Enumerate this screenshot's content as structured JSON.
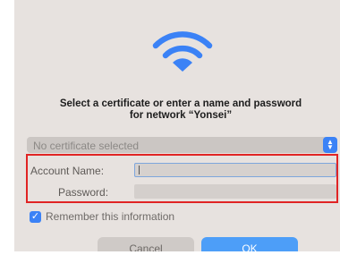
{
  "dialog": {
    "icon": "wifi-icon",
    "heading_line1": "Select a certificate or enter a name and password",
    "heading_line2": "for network “Yonsei”"
  },
  "certificate": {
    "selected": "No certificate selected",
    "icon": "chevron-updown-icon"
  },
  "credentials": {
    "account_label": "Account Name:",
    "account_value": "",
    "password_label": "Password:",
    "password_value": ""
  },
  "remember": {
    "label": "Remember this information",
    "checked": true
  },
  "buttons": {
    "cancel": "Cancel",
    "ok": "OK"
  },
  "colors": {
    "accent": "#3b82f6",
    "highlight": "#e02424",
    "dialog_bg": "#e7e2df"
  }
}
